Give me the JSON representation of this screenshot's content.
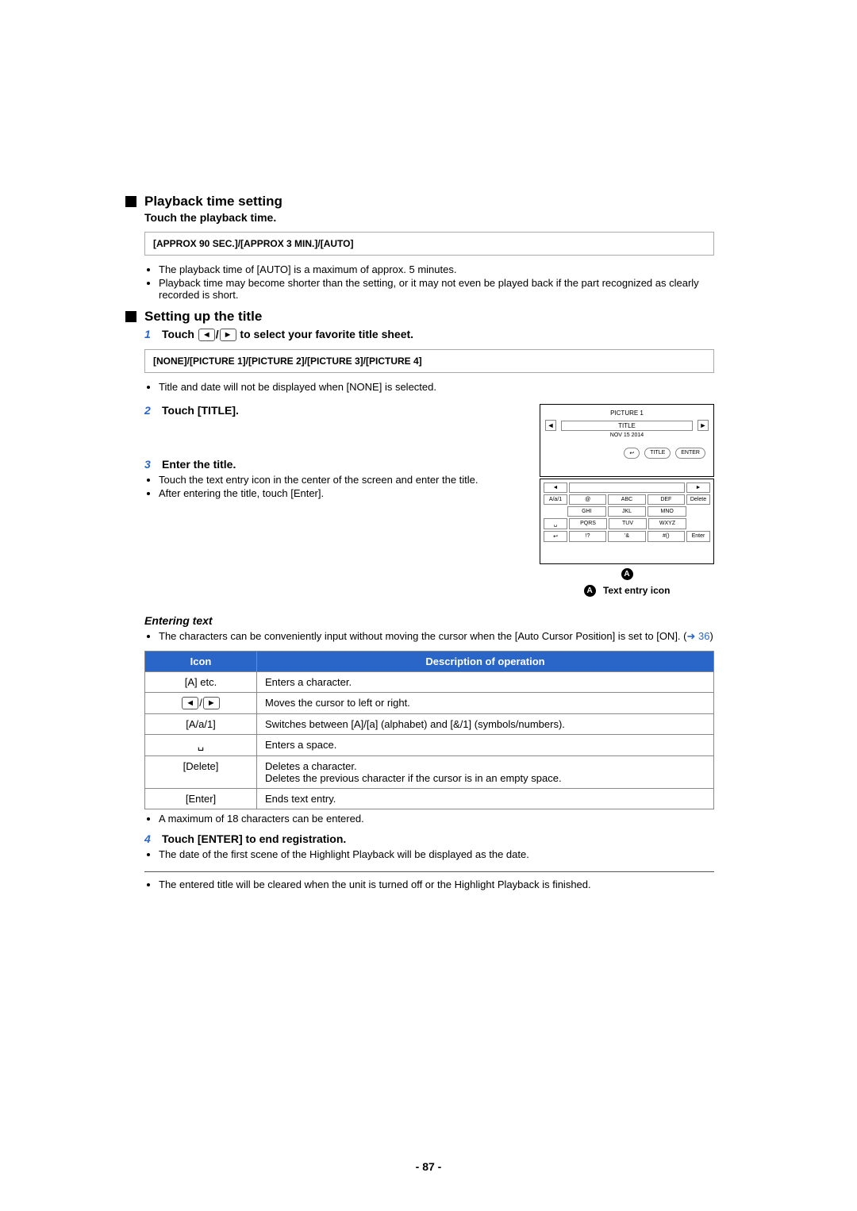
{
  "section1": {
    "heading": "Playback time setting",
    "sub": "Touch the playback time.",
    "options": "[APPROX 90 SEC.]/[APPROX 3 MIN.]/[AUTO]",
    "b1": "The playback time of [AUTO] is a maximum of approx. 5 minutes.",
    "b2": "Playback time may become shorter than the setting, or it may not even be played back if the part recognized as clearly recorded is short."
  },
  "section2": {
    "heading": "Setting up the title",
    "step1_pre": "Touch ",
    "step1_post": " to select your favorite title sheet.",
    "options": "[NONE]/[PICTURE 1]/[PICTURE 2]/[PICTURE 3]/[PICTURE 4]",
    "b1": "Title and date will not be displayed when [NONE] is selected.",
    "step2": "Touch [TITLE].",
    "step3": "Enter the title.",
    "s3b1": "Touch the text entry icon in the center of the screen and enter the title.",
    "s3b2": "After entering the title, touch [Enter]."
  },
  "screens": {
    "s1": {
      "picture": "PICTURE 1",
      "title": "TITLE",
      "date": "NOV 15 2014",
      "back": "↩",
      "btitle": "TITLE",
      "enter": "ENTER"
    },
    "s2": {
      "row0": [
        "◄",
        "",
        "",
        "►"
      ],
      "keys": [
        [
          "A/a/1",
          "@",
          "ABC",
          "DEF",
          "Delete"
        ],
        [
          "",
          "GHI",
          "JKL",
          "MNO",
          ""
        ],
        [
          "␣",
          "PQRS",
          "TUV",
          "WXYZ",
          ""
        ],
        [
          "↩",
          "!?",
          "'&",
          "#()",
          "Enter"
        ]
      ]
    },
    "markerA": "A",
    "caption": "Text entry icon"
  },
  "entering": {
    "heading": "Entering text",
    "b1_pre": "The characters can be conveniently input without moving the cursor when the [Auto Cursor Position] is set to [ON]. (",
    "b1_arrow": "➜",
    "b1_link": "36",
    "b1_post": ")"
  },
  "table": {
    "h1": "Icon",
    "h2": "Description of operation",
    "rows": [
      {
        "icon": "[A] etc.",
        "desc": "Enters a character."
      },
      {
        "icon": "__ARROWS__",
        "desc": "Moves the cursor to left or right."
      },
      {
        "icon": "[A/a/1]",
        "desc": "Switches between [A]/[a] (alphabet) and [&/1] (symbols/numbers)."
      },
      {
        "icon": "␣",
        "desc": "Enters a space."
      },
      {
        "icon": "[Delete]",
        "desc": "Deletes a character.\nDeletes the previous character if the cursor is in an empty space."
      },
      {
        "icon": "[Enter]",
        "desc": "Ends text entry."
      }
    ]
  },
  "after": {
    "b1": "A maximum of 18 characters can be entered.",
    "step4": "Touch [ENTER] to end registration.",
    "b2": "The date of the first scene of the Highlight Playback will be displayed as the date.",
    "b3": "The entered title will be cleared when the unit is turned off or the Highlight Playback is finished."
  },
  "pagenum": "- 87 -"
}
